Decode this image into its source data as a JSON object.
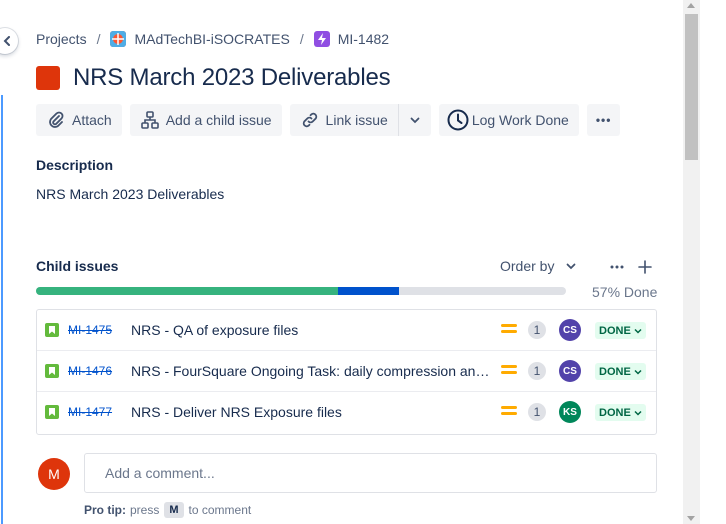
{
  "breadcrumb": {
    "projects": "Projects",
    "separator": "/",
    "project_name": "MAdTechBI-iSOCRATES",
    "issue_key": "MI-1482"
  },
  "issue": {
    "title": "NRS March 2023 Deliverables",
    "type_color": "#de350b"
  },
  "toolbar": {
    "attach": "Attach",
    "add_child": "Add a child issue",
    "link_issue": "Link issue",
    "log_work": "Log Work Done",
    "more": "•••"
  },
  "description": {
    "label": "Description",
    "text": "NRS March 2023 Deliverables"
  },
  "child_issues": {
    "label": "Child issues",
    "order_by": "Order by",
    "progress_text": "57% Done",
    "progress": {
      "done_fraction": 0.57,
      "in_progress_fraction": 0.115
    },
    "items": [
      {
        "key": "MI-1475",
        "summary": "NRS - QA of exposure files",
        "priority": "medium",
        "estimate": "1",
        "assignee": "CS",
        "assignee_color": "#5243aa",
        "status": "DONE"
      },
      {
        "key": "MI-1476",
        "summary": "NRS - FourSquare Ongoing Task: daily compression and transfer",
        "priority": "medium",
        "estimate": "1",
        "assignee": "CS",
        "assignee_color": "#5243aa",
        "status": "DONE"
      },
      {
        "key": "MI-1477",
        "summary": "NRS - Deliver NRS Exposure files",
        "priority": "medium",
        "estimate": "1",
        "assignee": "KS",
        "assignee_color": "#00875a",
        "status": "DONE"
      }
    ]
  },
  "comment": {
    "avatar_initial": "M",
    "placeholder": "Add a comment...",
    "pro_tip_label": "Pro tip:",
    "pro_tip_press": "press",
    "pro_tip_key": "M",
    "pro_tip_suffix": "to comment"
  },
  "colors": {
    "accent": "#0052cc",
    "done_green": "#36b37e",
    "priority_medium": "#ffab00"
  }
}
